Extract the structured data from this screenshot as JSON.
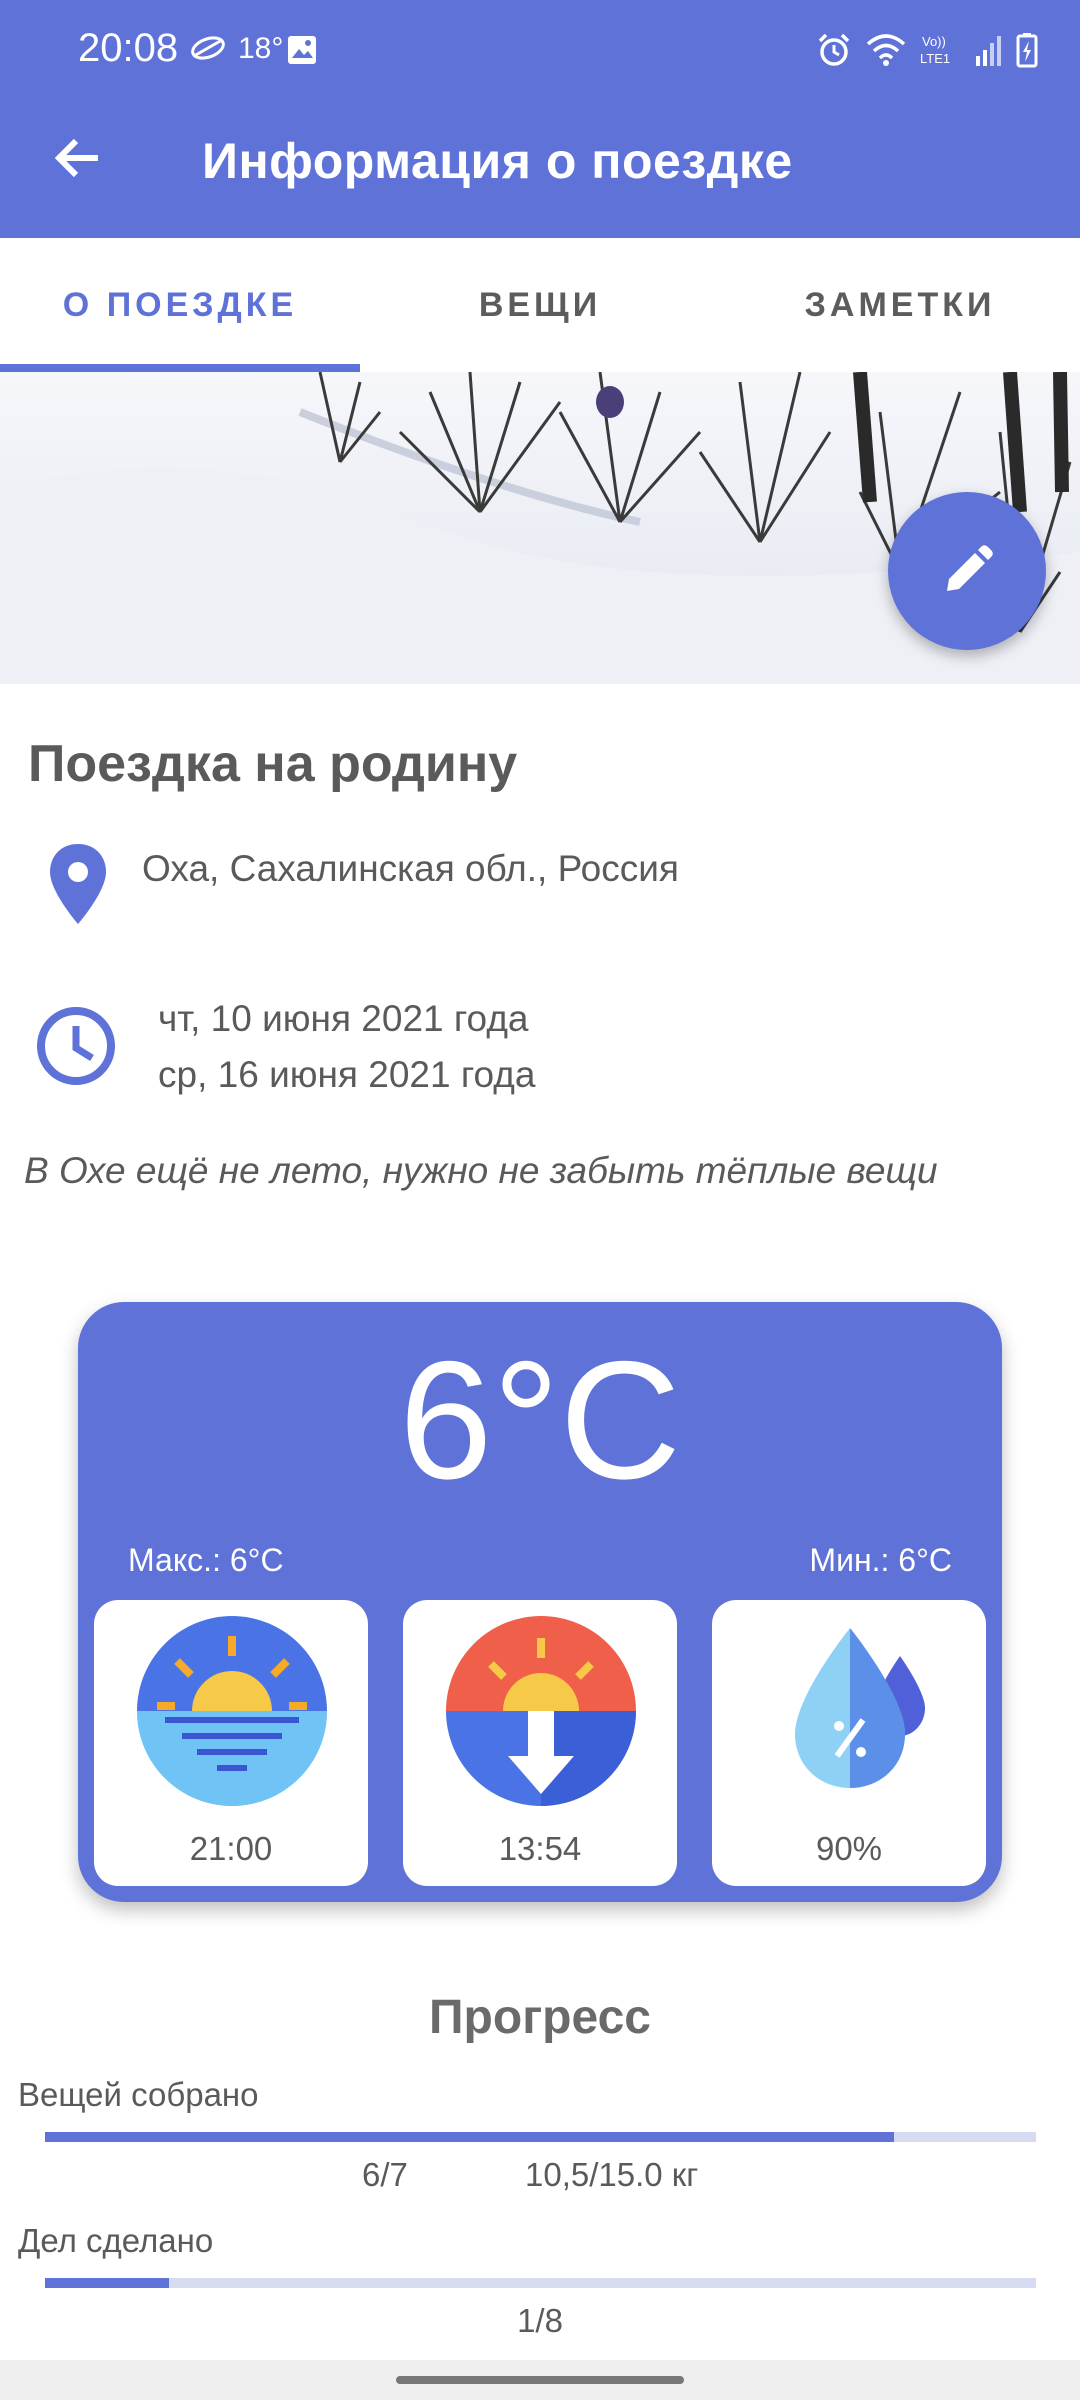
{
  "status_bar": {
    "time": "20:08",
    "temperature": "18°",
    "weather_icon": "cloud-icon",
    "gallery_icon": "image-icon"
  },
  "app_bar": {
    "title": "Информация о поездке",
    "back_icon": "arrow-back-icon"
  },
  "tabs": [
    {
      "label": "О ПОЕЗДКЕ",
      "active": true
    },
    {
      "label": "ВЕЩИ",
      "active": false
    },
    {
      "label": "ЗАМЕТКИ",
      "active": false
    }
  ],
  "trip": {
    "name": "Поездка на родину",
    "location": "Оха, Сахалинская обл., Россия",
    "date_start": "чт, 10 июня 2021 года",
    "date_end": "ср, 16 июня 2021 года",
    "note": "В Охе ещё не лето, нужно не забыть тёплые вещи"
  },
  "weather": {
    "temperature": "6°C",
    "max": "Макс.: 6°C",
    "min": "Мин.: 6°C",
    "sunset_time": "21:00",
    "sunrise_time": "13:54",
    "humidity": "90%"
  },
  "progress": {
    "title": "Прогресс",
    "items_label": "Вещей собрано",
    "items_count": "6/7",
    "items_weight": "10,5/15.0 кг",
    "items_fraction": 0.857,
    "tasks_label": "Дел сделано",
    "tasks_count": "1/8",
    "tasks_fraction": 0.125
  },
  "colors": {
    "primary": "#5f72d8",
    "track": "#d6dbf2"
  }
}
